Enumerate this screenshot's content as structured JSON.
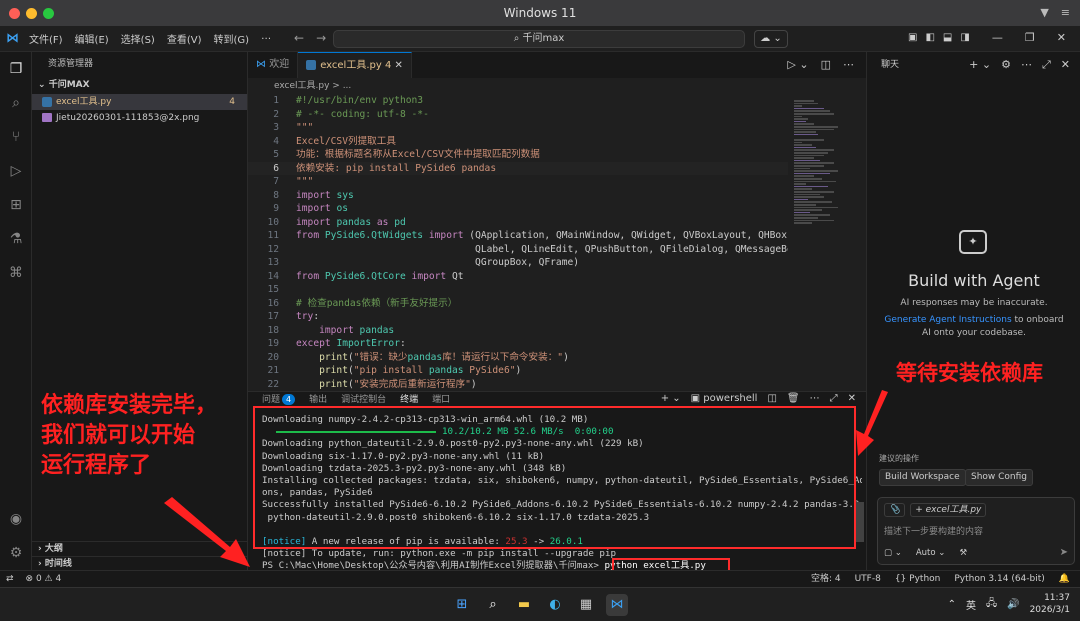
{
  "mac": {
    "title": "Windows 11"
  },
  "titlebar": {
    "menu": [
      "文件(F)",
      "编辑(E)",
      "选择(S)",
      "查看(V)",
      "转到(G)",
      "…"
    ],
    "search": "千问max"
  },
  "explorer": {
    "header": "资源管理器",
    "folder": "千问MAX",
    "files": [
      {
        "name": "excel工具.py",
        "badge": "4"
      },
      {
        "name": "Jietu20260301-111853@2x.png"
      }
    ],
    "outline": "大纲",
    "timeline": "时间线"
  },
  "editor": {
    "tabs": [
      {
        "label": "欢迎"
      },
      {
        "label": "excel工具.py",
        "badge": "4"
      }
    ],
    "breadcrumb": "excel工具.py > ...",
    "lines": [
      "#!/usr/bin/env python3",
      "# -*- coding: utf-8 -*-",
      "\"\"\"",
      "Excel/CSV列提取工具",
      "功能：根据标题名称从Excel/CSV文件中提取匹配列数据",
      "依赖安装: pip install PySide6 pandas",
      "\"\"\"",
      "import sys",
      "import os",
      "import pandas as pd",
      "from PySide6.QtWidgets import (QApplication, QMainWindow, QWidget, QVBoxLayout, QHBoxLayo",
      "                               QLabel, QLineEdit, QPushButton, QFileDialog, QMessageBox,",
      "                               QGroupBox, QFrame)",
      "from PySide6.QtCore import Qt",
      "",
      "# 检查pandas依赖（新手友好提示）",
      "try:",
      "    import pandas",
      "except ImportError:",
      "    print(\"错误：缺少pandas库！请运行以下命令安装：\")",
      "    print(\"pip install pandas PySide6\")",
      "    print(\"安装完成后重新运行程序\")"
    ]
  },
  "panel": {
    "tabs": [
      "问题",
      "输出",
      "调试控制台",
      "终端",
      "端口"
    ],
    "problems_badge": "4",
    "shell": "powershell",
    "terminal": [
      "Downloading numpy-2.4.2-cp313-cp313-win_arm64.whl (10.2 MB)",
      "10.2/10.2 MB 52.6 MB/s  0:00:00",
      "Downloading python_dateutil-2.9.0.post0-py2.py3-none-any.whl (229 kB)",
      "Downloading six-1.17.0-py2.py3-none-any.whl (11 kB)",
      "Downloading tzdata-2025.3-py2.py3-none-any.whl (348 kB)",
      "Installing collected packages: tzdata, six, shiboken6, numpy, python-dateutil, PySide6_Essentials, PySide6_Add",
      "ons, pandas, PySide6",
      "Successfully installed PySide6-6.10.2 PySide6_Addons-6.10.2 PySide6_Essentials-6.10.2 numpy-2.4.2 pandas-3.0.1",
      " python-dateutil-2.9.0.post0 shiboken6-6.10.2 six-1.17.0 tzdata-2025.3",
      "",
      "[notice] A new release of pip is available: 25.3 -> 26.0.1",
      "[notice] To update, run: python.exe -m pip install --upgrade pip",
      "PS C:\\Mac\\Home\\Desktop\\公众号内容\\利用AI制作Excel列提取器\\千问max>"
    ],
    "command": "python excel工具.py"
  },
  "annotations": {
    "left": [
      "依赖库安装完毕，",
      "我们就可以开始",
      "运行程序了"
    ],
    "right": "等待安装依赖库",
    "color": "#ff2121"
  },
  "chat": {
    "tab": "聊天",
    "title": "Build with Agent",
    "subtitle": "AI responses may be inaccurate.",
    "link": "Generate Agent Instructions",
    "link_after": " to onboard AI onto your codebase.",
    "suggest_label": "建议的操作",
    "buttons": [
      "Build Workspace",
      "Show Config"
    ],
    "chip": "excel工具.py",
    "placeholder": "描述下一步要构建的内容",
    "mode": "Auto"
  },
  "status": {
    "errors": "0",
    "warnings": "4",
    "spaces": "空格: 4",
    "encoding": "UTF-8",
    "lang": "Python",
    "interpreter": "Python 3.14 (64-bit)"
  },
  "taskbar": {
    "ime": "英",
    "time": "11:37",
    "date": "2026/3/1"
  }
}
